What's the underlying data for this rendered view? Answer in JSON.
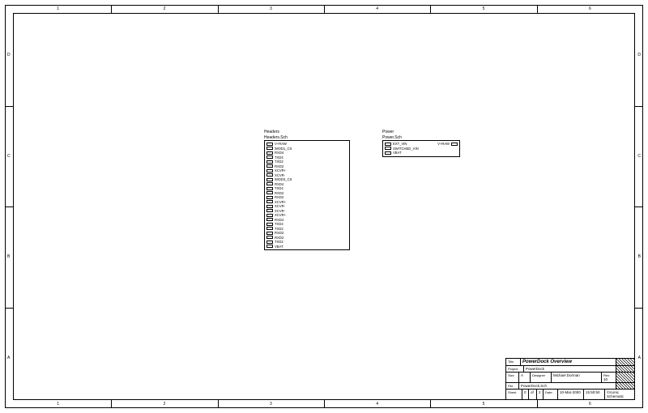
{
  "frame": {
    "cols": [
      "1",
      "2",
      "3",
      "4",
      "5",
      "6"
    ],
    "rows": [
      "D",
      "C",
      "B",
      "A"
    ]
  },
  "blocks": {
    "headers": {
      "title": "Headers",
      "subtitle": "Headers.Sch",
      "pins_left": [
        "V+RAW",
        "/MOD1_CS",
        "RXD4",
        "TXD4",
        "TXD2",
        "RXD2",
        "XCVR+",
        "XCVR-",
        "/MOD3_CS",
        "RXD4",
        "TXD4",
        "RXD2",
        "RXD2",
        "XCVR+",
        "XCVR-",
        "XCVR-",
        "XCVR+",
        "RXD4",
        "TXD4",
        "TXD2",
        "RXD2",
        "RXD2",
        "TXD2",
        "VBAT"
      ]
    },
    "power": {
      "title": "Power",
      "subtitle": "Power.Sch",
      "pins_left": [
        "EXT_VIN",
        "SWITCHED_VIN",
        "VBAT"
      ],
      "pins_right": [
        "V+RAW"
      ]
    }
  },
  "titleblock": {
    "title_label": "Title",
    "title": "PowerDock Overview",
    "project_label": "Project",
    "project": "PowerDock",
    "size_label": "Size",
    "size": "A",
    "designer_label": "Designer",
    "designer": "Michael Dorman",
    "rev_label": "Rev:",
    "rev": "10",
    "file_label": "File",
    "file": "PowerDock.Sch",
    "sheet_label": "Sheet",
    "sheet_current": "0",
    "sheet_sep": "of",
    "sheet_total": "2",
    "date_label": "Date:",
    "date": "10-Mar-2000",
    "time": "15:50:50",
    "corner": "©Iconic Schematic"
  }
}
